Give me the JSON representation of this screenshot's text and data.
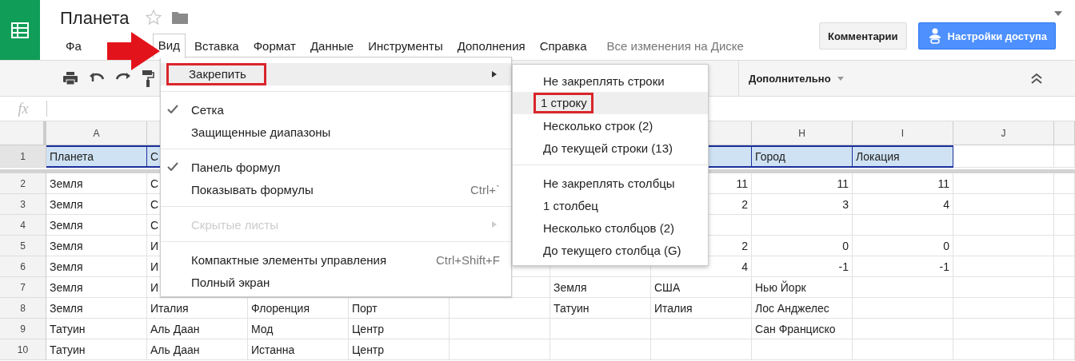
{
  "document": {
    "title": "Планета",
    "starred": false
  },
  "menu_bar": [
    {
      "label": "Фа",
      "selected": false
    },
    {
      "label": "Вид",
      "selected": true
    },
    {
      "label": "Вставка",
      "selected": false
    },
    {
      "label": "Формат",
      "selected": false
    },
    {
      "label": "Данные",
      "selected": false
    },
    {
      "label": "Инструменты",
      "selected": false
    },
    {
      "label": "Дополнения",
      "selected": false
    },
    {
      "label": "Справка",
      "selected": false
    }
  ],
  "save_status": "Все изменения на Диске",
  "buttons": [
    {
      "label": "Комментарии",
      "kind": "plain"
    },
    {
      "label": "Настройки доступа",
      "kind": "share"
    }
  ],
  "toolbar": {
    "more_label": "Дополнительно"
  },
  "formula_bar": {
    "label": "fx"
  },
  "columns": [
    "A",
    null,
    null,
    null,
    null,
    null,
    null,
    "H",
    "I",
    "J",
    null
  ],
  "rows": [
    {
      "number": "1",
      "selected": true,
      "cells": [
        "Планета",
        "С",
        null,
        null,
        null,
        null,
        null,
        "Город",
        "Локация",
        null,
        null
      ]
    },
    {
      "number": "2",
      "selected": false,
      "cells": [
        "Земля",
        "С",
        null,
        null,
        null,
        null,
        {
          "text": "11",
          "kind": "number"
        },
        {
          "text": "11",
          "kind": "number"
        },
        {
          "text": "11",
          "kind": "number"
        },
        null,
        null
      ]
    },
    {
      "number": "3",
      "selected": false,
      "cells": [
        "Земля",
        "С",
        null,
        null,
        null,
        null,
        {
          "text": "2",
          "kind": "number"
        },
        {
          "text": "3",
          "kind": "number"
        },
        {
          "text": "4",
          "kind": "number"
        },
        null,
        null
      ]
    },
    {
      "number": "4",
      "selected": false,
      "cells": [
        "Земля",
        "С",
        null,
        null,
        null,
        null,
        null,
        null,
        null,
        null,
        null
      ]
    },
    {
      "number": "5",
      "selected": false,
      "cells": [
        "Земля",
        "И",
        null,
        null,
        null,
        null,
        {
          "text": "2",
          "kind": "number"
        },
        {
          "text": "0",
          "kind": "number"
        },
        {
          "text": "0",
          "kind": "number"
        },
        null,
        null
      ]
    },
    {
      "number": "6",
      "selected": false,
      "cells": [
        "Земля",
        "И",
        null,
        null,
        null,
        null,
        {
          "text": "4",
          "kind": "number"
        },
        {
          "text": "-1",
          "kind": "number"
        },
        {
          "text": "-1",
          "kind": "number"
        },
        null,
        null
      ]
    },
    {
      "number": "7",
      "selected": false,
      "cells": [
        "Земля",
        "И",
        null,
        null,
        null,
        "Земля",
        "США",
        "Нью Йорк",
        null,
        null,
        null
      ]
    },
    {
      "number": "8",
      "selected": false,
      "cells": [
        "Земля",
        "Италия",
        "Флоренция",
        "Порт",
        null,
        "Татуин",
        "Италия",
        "Лос Анджелес",
        null,
        null,
        null
      ]
    },
    {
      "number": "9",
      "selected": false,
      "cells": [
        "Татуин",
        "Аль Даан",
        "Мод",
        "Центр",
        null,
        null,
        null,
        "Сан Франциско",
        null,
        null,
        null
      ]
    },
    {
      "number": "10",
      "selected": false,
      "cells": [
        "Татуин",
        "Аль Даан",
        "Истанна",
        "Центр",
        null,
        null,
        null,
        null,
        null,
        null,
        null
      ]
    }
  ],
  "view_menu": [
    {
      "kind": "item",
      "label": "Закрепить",
      "submenu": true,
      "selected": true,
      "checked": false,
      "disabled": false,
      "annotated": true
    },
    {
      "kind": "separator"
    },
    {
      "kind": "item",
      "label": "Сетка",
      "submenu": false,
      "selected": false,
      "checked": true,
      "disabled": false,
      "annotated": false
    },
    {
      "kind": "item",
      "label": "Защищенные диапазоны",
      "submenu": false,
      "selected": false,
      "checked": false,
      "disabled": false,
      "annotated": false
    },
    {
      "kind": "separator"
    },
    {
      "kind": "item",
      "label": "Панель формул",
      "submenu": false,
      "selected": false,
      "checked": true,
      "disabled": false,
      "annotated": false
    },
    {
      "kind": "item",
      "label": "Показывать формулы",
      "shortcut": "Ctrl+`",
      "submenu": false,
      "selected": false,
      "checked": false,
      "disabled": false,
      "annotated": false
    },
    {
      "kind": "separator"
    },
    {
      "kind": "item",
      "label": "Скрытые листы",
      "submenu": true,
      "selected": false,
      "checked": false,
      "disabled": true,
      "annotated": false
    },
    {
      "kind": "separator"
    },
    {
      "kind": "item",
      "label": "Компактные элементы управления",
      "shortcut": "Ctrl+Shift+F",
      "submenu": false,
      "selected": false,
      "checked": false,
      "disabled": false,
      "annotated": false
    },
    {
      "kind": "item",
      "label": "Полный экран",
      "submenu": false,
      "selected": false,
      "checked": false,
      "disabled": false,
      "annotated": false
    }
  ],
  "freeze_submenu": [
    {
      "kind": "item",
      "label": "Не закреплять строки",
      "selected": false,
      "annotated": false
    },
    {
      "kind": "item",
      "label": "1 строку",
      "selected": true,
      "annotated": true
    },
    {
      "kind": "item",
      "label": "Несколько строк (2)",
      "selected": false,
      "annotated": false
    },
    {
      "kind": "item",
      "label": "До текущей строки (13)",
      "selected": false,
      "annotated": false
    },
    {
      "kind": "separator"
    },
    {
      "kind": "item",
      "label": "Не закреплять столбцы",
      "selected": false,
      "annotated": false
    },
    {
      "kind": "item",
      "label": "1 столбец",
      "selected": false,
      "annotated": false
    },
    {
      "kind": "item",
      "label": "Несколько столбцов (2)",
      "selected": false,
      "annotated": false
    },
    {
      "kind": "item",
      "label": "До текущего столбца (G)",
      "selected": false,
      "annotated": false
    }
  ]
}
